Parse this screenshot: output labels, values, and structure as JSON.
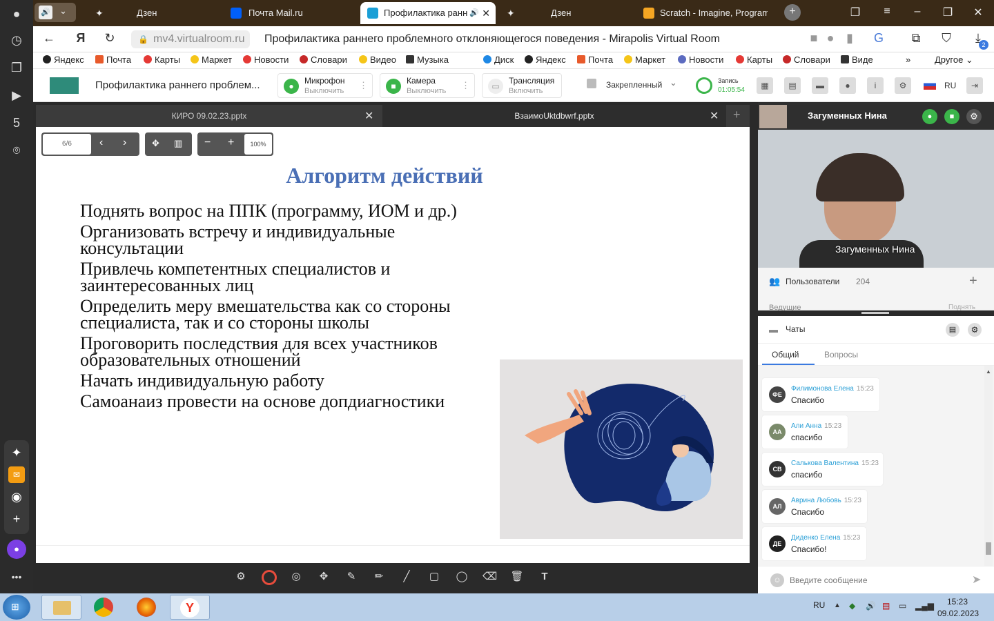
{
  "browser": {
    "tabs": [
      {
        "label": "Дзен",
        "color": "#222"
      },
      {
        "label": "Почта Mail.ru",
        "color": "#005ff9"
      },
      {
        "label": "Профилактика ранн",
        "color": "#1a9fd6"
      },
      {
        "label": "Дзен",
        "color": "#222"
      },
      {
        "label": "Scratch - Imagine, Program",
        "color": "#f5a623"
      }
    ],
    "url": "mv4.virtualroom.ru",
    "page_title": "Профилактика раннего проблемного отклоняющегося поведения - Mirapolis Virtual Room",
    "downloads_badge": "2",
    "bookmarks": [
      "Яндекс",
      "Почта",
      "Карты",
      "Маркет",
      "Новости",
      "Словари",
      "Видео",
      "Музыка",
      "Диск",
      "Яндекс",
      "Почта",
      "Маркет",
      "Новости",
      "Карты",
      "Словари",
      "Виде"
    ],
    "bookmarks_more": "Другое"
  },
  "toolbar": {
    "room_title": "Профилактика раннего проблем...",
    "mic": {
      "label": "Микрофон",
      "sub": "Выключить"
    },
    "camera": {
      "label": "Камера",
      "sub": "Выключить"
    },
    "broadcast": {
      "label": "Трансляция",
      "sub": "Включить"
    },
    "pinned": "Закрепленный",
    "rec_label": "Запись",
    "rec_time": "01:05:54",
    "lang": "RU"
  },
  "presentation": {
    "tabs": [
      "КИРО 09.02.23.pptx",
      "ВзаимоUktdbwrf.pptx"
    ],
    "page": "6/6",
    "zoom": "100%",
    "slide_title": "Алгоритм действий",
    "lines": [
      "Поднять вопрос на ППК (программу, ИОМ и др.)",
      "Организовать встречу и индивидуальные",
      "консультации",
      "Привлечь компетентных специалистов и",
      "заинтересованных лиц",
      "Определить меру вмешательства как со стороны",
      "специалиста, так и со стороны школы",
      "Проговорить последствия для всех участников",
      "образовательных отношений",
      "Начать индивидуальную работу",
      "Самоанаиз провести на основе допдиагностики"
    ]
  },
  "right": {
    "presenter": "Загуменных Нина",
    "video_caption": "Загуменных Нина",
    "users_label": "Пользователи",
    "users_count": "204",
    "users_sub_left": "Ведущие",
    "users_sub_right": "Поднять",
    "chats_label": "Чаты",
    "chat_tabs": [
      "Общий",
      "Вопросы"
    ],
    "messages": [
      {
        "initials": "ФЕ",
        "name": "Филимонова Елена",
        "time": "15:23",
        "text": "Спасибо"
      },
      {
        "initials": "АА",
        "name": "Али Анна",
        "time": "15:23",
        "text": "спасибо"
      },
      {
        "initials": "СВ",
        "name": "Салькова Валентина",
        "time": "15:23",
        "text": "спасибо"
      },
      {
        "initials": "АЛ",
        "name": "Аврина Любовь",
        "time": "15:23",
        "text": "Спасибо"
      },
      {
        "initials": "ДЕ",
        "name": "Диденко Елена",
        "time": "15:23",
        "text": "Спасибо!"
      }
    ],
    "input_placeholder": "Введите сообщение"
  },
  "taskbar": {
    "lang": "RU",
    "time": "15:23",
    "date": "09.02.2023"
  }
}
